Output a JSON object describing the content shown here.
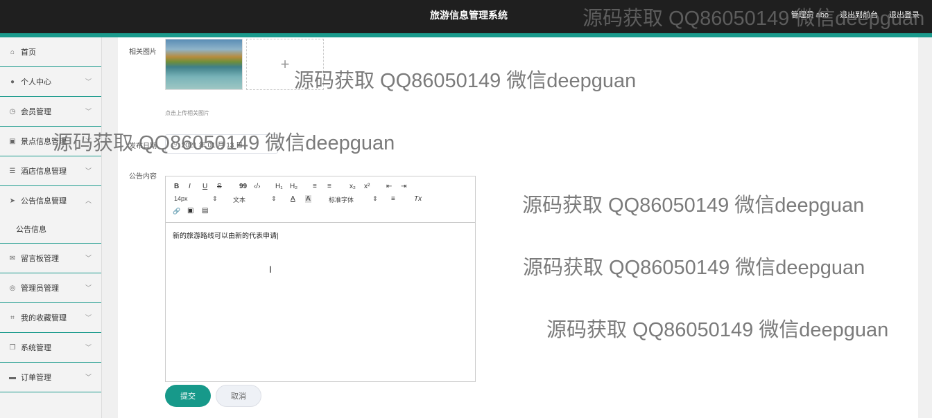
{
  "header": {
    "title": "旅游信息管理系统",
    "user": "管理员 abo",
    "front_link": "退出到前台",
    "logout": "退出登录"
  },
  "sidebar": {
    "items": [
      {
        "label": "首页",
        "icon": "home-icon"
      },
      {
        "label": "个人中心",
        "icon": "user-icon"
      },
      {
        "label": "会员管理",
        "icon": "clock-icon"
      },
      {
        "label": "景点信息管理",
        "icon": "clipboard-icon"
      },
      {
        "label": "酒店信息管理",
        "icon": "list-icon"
      },
      {
        "label": "公告信息管理",
        "icon": "send-icon",
        "expanded": true,
        "sub": "公告信息"
      },
      {
        "label": "留言板管理",
        "icon": "mail-icon"
      },
      {
        "label": "管理员管理",
        "icon": "globe-icon"
      },
      {
        "label": "我的收藏管理",
        "icon": "crop-icon"
      },
      {
        "label": "系统管理",
        "icon": "copy-icon"
      },
      {
        "label": "订单管理",
        "icon": "message-icon"
      }
    ]
  },
  "form": {
    "image_label": "相关图片",
    "upload_plus": "+",
    "upload_hint": "点击上传相关图片",
    "date_label": "发布日期",
    "date_value": "2021 年 01 月 13 日",
    "content_label": "公告内容",
    "content_text": "新的旅游路线可以由新的代表申请",
    "submit": "提交",
    "cancel": "取消"
  },
  "editor_toolbar": {
    "bold": "B",
    "italic": "I",
    "underline": "U",
    "strike": "S",
    "quote": "99",
    "code": "‹/›",
    "h1": "H₁",
    "h2": "H₂",
    "ol": "≡",
    "ul": "≡",
    "sub": "x₂",
    "sup": "x²",
    "outdent": "⇤",
    "indent": "⇥",
    "size": "14px",
    "header_sel": "文本",
    "color": "A",
    "bg": "A",
    "font": "标准字体",
    "align": "≡",
    "clear": "Tx",
    "link": "🔗",
    "image": "▣",
    "video": "▤"
  },
  "watermarks": [
    "源码获取 QQ86050149 微信deepguan",
    "源码获取 QQ86050149 微信deepguan",
    "源码获取 QQ86050149 微信deepguan",
    "源码获取 QQ86050149 微信deepguan",
    "源码获取 QQ86050149 微信deepguan",
    "源码获取 QQ86050149 微信deepguan"
  ]
}
